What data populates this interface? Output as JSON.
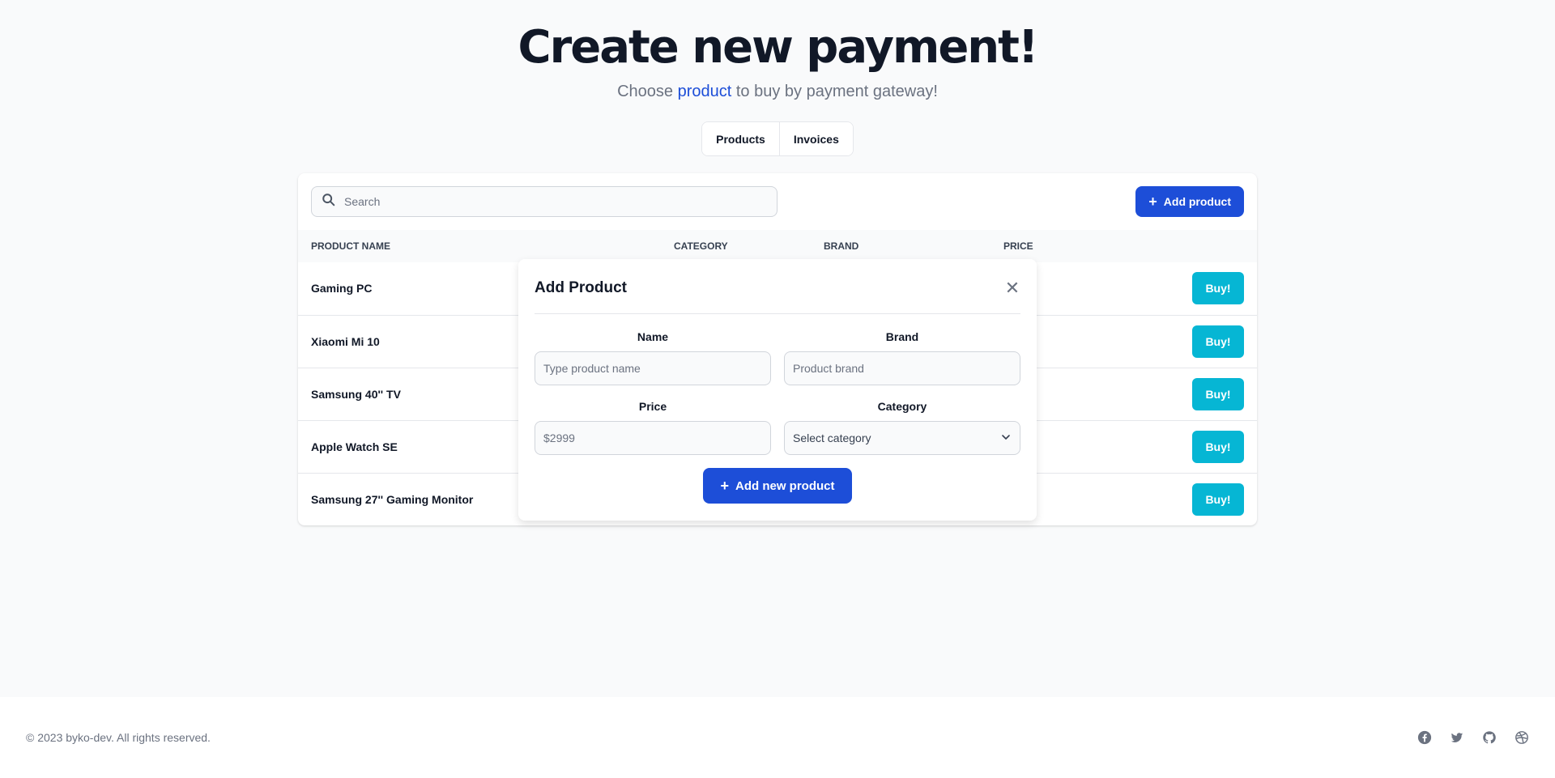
{
  "hero": {
    "title": "Create new payment!",
    "subtitle_pre": "Choose",
    "subtitle_highlight": "product",
    "subtitle_post": "to buy by payment gateway!"
  },
  "tabs": [
    {
      "label": "Products"
    },
    {
      "label": "Invoices"
    }
  ],
  "toolbar": {
    "search_placeholder": "Search",
    "add_product_label": "Add product"
  },
  "table": {
    "columns": [
      "PRODUCT NAME",
      "CATEGORY",
      "BRAND",
      "PRICE"
    ],
    "rows": [
      {
        "name": "Gaming PC",
        "action": "Buy!"
      },
      {
        "name": "Xiaomi Mi 10",
        "action": "Buy!"
      },
      {
        "name": "Samsung 40'' TV",
        "action": "Buy!"
      },
      {
        "name": "Apple Watch SE",
        "action": "Buy!"
      },
      {
        "name": "Samsung 27'' Gaming Monitor",
        "action": "Buy!"
      }
    ]
  },
  "modal": {
    "title": "Add Product",
    "close_glyph": "✕",
    "fields": {
      "name": {
        "label": "Name",
        "placeholder": "Type product name"
      },
      "brand": {
        "label": "Brand",
        "placeholder": "Product brand"
      },
      "price": {
        "label": "Price",
        "placeholder": "$2999"
      },
      "category": {
        "label": "Category",
        "value": "Select category"
      }
    },
    "submit_label": "Add new product"
  },
  "footer": {
    "copyright": "© 2023 byko-dev. All rights reserved.",
    "social": [
      "facebook-icon",
      "twitter-icon",
      "github-icon",
      "dribbble-icon"
    ]
  },
  "colors": {
    "primary": "#1d4ed8",
    "buy": "#06b6d4",
    "text": "#111827",
    "muted": "#6b7280"
  }
}
